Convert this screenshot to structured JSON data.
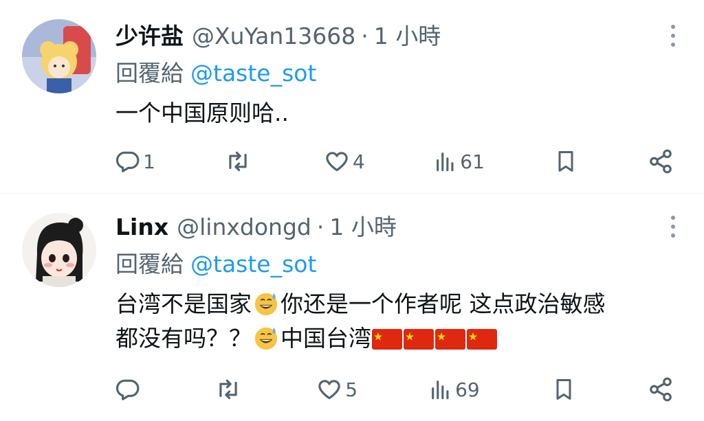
{
  "tweets": [
    {
      "name": "少许盐",
      "handle": "@XuYan13668",
      "separator": "·",
      "time": "1 小時",
      "reply_prefix": "回覆給",
      "reply_to": "@taste_sot",
      "text_line1": "一个中国原则哈..",
      "counts": {
        "replies": "1",
        "retweets": "",
        "likes": "4",
        "views": "61"
      }
    },
    {
      "name": "Linx",
      "handle": "@linxdongd",
      "separator": "·",
      "time": "1 小時",
      "reply_prefix": "回覆給",
      "reply_to": "@taste_sot",
      "text_part1": "台湾不是国家",
      "text_part2": "你还是一个作者呢 这点政治敏感",
      "text_part3": "都没有吗？？",
      "text_part4": "中国台湾",
      "counts": {
        "replies": "",
        "retweets": "",
        "likes": "5",
        "views": "69"
      }
    }
  ],
  "icons": {
    "reply": "speech-bubble-icon",
    "retweet": "retweet-arrows-icon",
    "like": "heart-outline-icon",
    "views": "bar-chart-icon",
    "bookmark": "bookmark-icon",
    "share": "share-icon",
    "more": "vertical-dots-icon",
    "emoji": "grinning-sweat-emoji",
    "flag": "china-flag-emoji"
  },
  "colors": {
    "text": "#0f1419",
    "secondary": "#536471",
    "link": "#1d9bf0",
    "divider": "#eff3f4"
  }
}
